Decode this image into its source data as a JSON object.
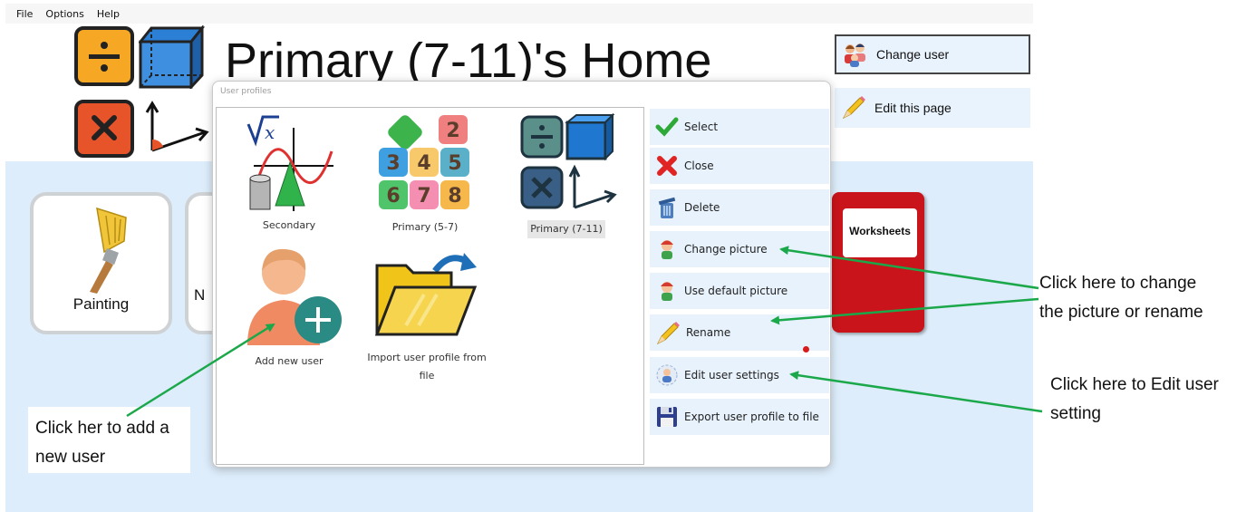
{
  "menu": {
    "items": [
      "File",
      "Options",
      "Help"
    ]
  },
  "header": {
    "title": "Primary (7-11)'s Home"
  },
  "side_buttons": {
    "change_user": "Change user",
    "edit_page": "Edit this page"
  },
  "tiles": {
    "painting": "Painting",
    "partial_letter": "N",
    "worksheets": "Worksheets"
  },
  "dialog": {
    "title": "User profiles",
    "profiles": [
      {
        "label": "Secondary",
        "icon": "math-graph-icon"
      },
      {
        "label": "Primary (5-7)",
        "icon": "number-blocks-icon"
      },
      {
        "label": "Primary (7-11)",
        "icon": "math-symbols-icon",
        "selected": true
      },
      {
        "label": "Add new user",
        "icon": "add-user-icon"
      },
      {
        "label": "Import user profile from file",
        "icon": "import-folder-icon"
      }
    ],
    "actions": [
      {
        "label": "Select",
        "icon": "checkmark-icon"
      },
      {
        "label": "Close",
        "icon": "close-icon"
      },
      {
        "label": "Delete",
        "icon": "trash-icon"
      },
      {
        "label": "Change picture",
        "icon": "avatar-icon"
      },
      {
        "label": "Use default picture",
        "icon": "avatar-icon"
      },
      {
        "label": "Rename",
        "icon": "pencil-icon"
      },
      {
        "label": "Edit user settings",
        "icon": "user-settings-icon"
      },
      {
        "label": "Export user profile to file",
        "icon": "floppy-disk-icon"
      }
    ]
  },
  "annotations": {
    "change_picture_line1": "Click here to change",
    "change_picture_line2": "the picture or rename",
    "edit_settings_line1": "Click here to Edit user",
    "edit_settings_line2": "setting",
    "add_user_line1": "Click her to add a",
    "add_user_line2": "new user"
  },
  "colors": {
    "arrow": "#1aa84a",
    "panel": "#deedfb",
    "button": "#e7f2fc"
  }
}
